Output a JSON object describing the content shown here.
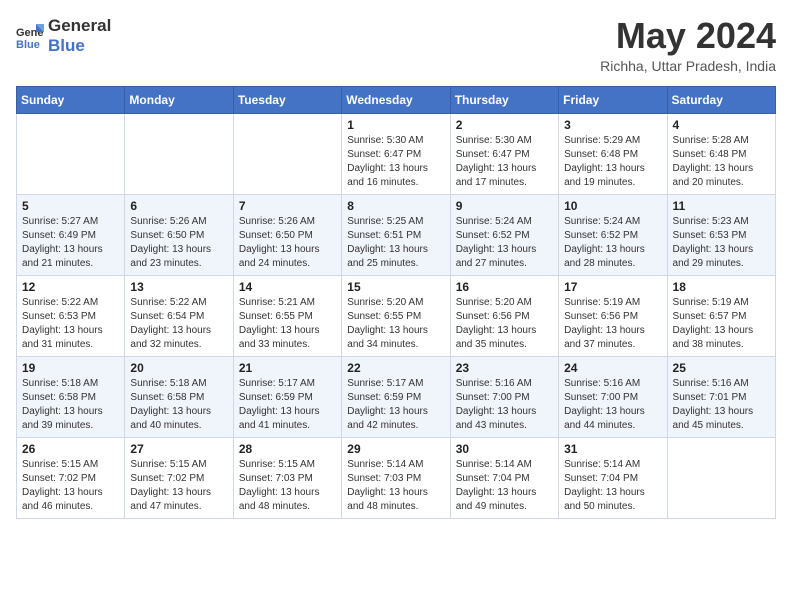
{
  "logo": {
    "general": "General",
    "blue": "Blue"
  },
  "header": {
    "month_year": "May 2024",
    "location": "Richha, Uttar Pradesh, India"
  },
  "weekdays": [
    "Sunday",
    "Monday",
    "Tuesday",
    "Wednesday",
    "Thursday",
    "Friday",
    "Saturday"
  ],
  "weeks": [
    [
      {
        "day": "",
        "info": ""
      },
      {
        "day": "",
        "info": ""
      },
      {
        "day": "",
        "info": ""
      },
      {
        "day": "1",
        "info": "Sunrise: 5:30 AM\nSunset: 6:47 PM\nDaylight: 13 hours\nand 16 minutes."
      },
      {
        "day": "2",
        "info": "Sunrise: 5:30 AM\nSunset: 6:47 PM\nDaylight: 13 hours\nand 17 minutes."
      },
      {
        "day": "3",
        "info": "Sunrise: 5:29 AM\nSunset: 6:48 PM\nDaylight: 13 hours\nand 19 minutes."
      },
      {
        "day": "4",
        "info": "Sunrise: 5:28 AM\nSunset: 6:48 PM\nDaylight: 13 hours\nand 20 minutes."
      }
    ],
    [
      {
        "day": "5",
        "info": "Sunrise: 5:27 AM\nSunset: 6:49 PM\nDaylight: 13 hours\nand 21 minutes."
      },
      {
        "day": "6",
        "info": "Sunrise: 5:26 AM\nSunset: 6:50 PM\nDaylight: 13 hours\nand 23 minutes."
      },
      {
        "day": "7",
        "info": "Sunrise: 5:26 AM\nSunset: 6:50 PM\nDaylight: 13 hours\nand 24 minutes."
      },
      {
        "day": "8",
        "info": "Sunrise: 5:25 AM\nSunset: 6:51 PM\nDaylight: 13 hours\nand 25 minutes."
      },
      {
        "day": "9",
        "info": "Sunrise: 5:24 AM\nSunset: 6:52 PM\nDaylight: 13 hours\nand 27 minutes."
      },
      {
        "day": "10",
        "info": "Sunrise: 5:24 AM\nSunset: 6:52 PM\nDaylight: 13 hours\nand 28 minutes."
      },
      {
        "day": "11",
        "info": "Sunrise: 5:23 AM\nSunset: 6:53 PM\nDaylight: 13 hours\nand 29 minutes."
      }
    ],
    [
      {
        "day": "12",
        "info": "Sunrise: 5:22 AM\nSunset: 6:53 PM\nDaylight: 13 hours\nand 31 minutes."
      },
      {
        "day": "13",
        "info": "Sunrise: 5:22 AM\nSunset: 6:54 PM\nDaylight: 13 hours\nand 32 minutes."
      },
      {
        "day": "14",
        "info": "Sunrise: 5:21 AM\nSunset: 6:55 PM\nDaylight: 13 hours\nand 33 minutes."
      },
      {
        "day": "15",
        "info": "Sunrise: 5:20 AM\nSunset: 6:55 PM\nDaylight: 13 hours\nand 34 minutes."
      },
      {
        "day": "16",
        "info": "Sunrise: 5:20 AM\nSunset: 6:56 PM\nDaylight: 13 hours\nand 35 minutes."
      },
      {
        "day": "17",
        "info": "Sunrise: 5:19 AM\nSunset: 6:56 PM\nDaylight: 13 hours\nand 37 minutes."
      },
      {
        "day": "18",
        "info": "Sunrise: 5:19 AM\nSunset: 6:57 PM\nDaylight: 13 hours\nand 38 minutes."
      }
    ],
    [
      {
        "day": "19",
        "info": "Sunrise: 5:18 AM\nSunset: 6:58 PM\nDaylight: 13 hours\nand 39 minutes."
      },
      {
        "day": "20",
        "info": "Sunrise: 5:18 AM\nSunset: 6:58 PM\nDaylight: 13 hours\nand 40 minutes."
      },
      {
        "day": "21",
        "info": "Sunrise: 5:17 AM\nSunset: 6:59 PM\nDaylight: 13 hours\nand 41 minutes."
      },
      {
        "day": "22",
        "info": "Sunrise: 5:17 AM\nSunset: 6:59 PM\nDaylight: 13 hours\nand 42 minutes."
      },
      {
        "day": "23",
        "info": "Sunrise: 5:16 AM\nSunset: 7:00 PM\nDaylight: 13 hours\nand 43 minutes."
      },
      {
        "day": "24",
        "info": "Sunrise: 5:16 AM\nSunset: 7:00 PM\nDaylight: 13 hours\nand 44 minutes."
      },
      {
        "day": "25",
        "info": "Sunrise: 5:16 AM\nSunset: 7:01 PM\nDaylight: 13 hours\nand 45 minutes."
      }
    ],
    [
      {
        "day": "26",
        "info": "Sunrise: 5:15 AM\nSunset: 7:02 PM\nDaylight: 13 hours\nand 46 minutes."
      },
      {
        "day": "27",
        "info": "Sunrise: 5:15 AM\nSunset: 7:02 PM\nDaylight: 13 hours\nand 47 minutes."
      },
      {
        "day": "28",
        "info": "Sunrise: 5:15 AM\nSunset: 7:03 PM\nDaylight: 13 hours\nand 48 minutes."
      },
      {
        "day": "29",
        "info": "Sunrise: 5:14 AM\nSunset: 7:03 PM\nDaylight: 13 hours\nand 48 minutes."
      },
      {
        "day": "30",
        "info": "Sunrise: 5:14 AM\nSunset: 7:04 PM\nDaylight: 13 hours\nand 49 minutes."
      },
      {
        "day": "31",
        "info": "Sunrise: 5:14 AM\nSunset: 7:04 PM\nDaylight: 13 hours\nand 50 minutes."
      },
      {
        "day": "",
        "info": ""
      }
    ]
  ]
}
